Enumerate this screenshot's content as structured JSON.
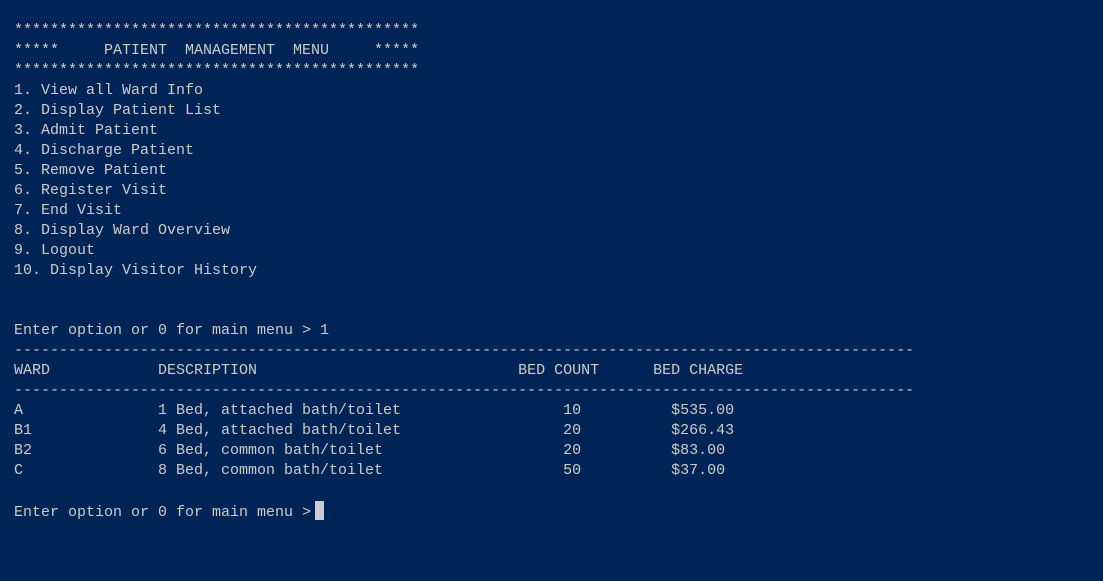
{
  "colors": {
    "background": "#012456",
    "text": "#cccccc"
  },
  "banner": {
    "border": "*********************************************",
    "title_line": "*****     PATIENT  MANAGEMENT  MENU     *****"
  },
  "menu": [
    "1. View all Ward Info",
    "2. Display Patient List",
    "3. Admit Patient",
    "4. Discharge Patient",
    "5. Remove Patient",
    "6. Register Visit",
    "7. End Visit",
    "8. Display Ward Overview",
    "9. Logout",
    "10. Display Visitor History"
  ],
  "first_prompt": "Enter option or 0 for main menu > 1",
  "separator": "----------------------------------------------------------------------------------------------------",
  "table": {
    "headers": {
      "ward": "WARD",
      "description": "DESCRIPTION",
      "bed_count": "BED COUNT",
      "bed_charge": "BED CHARGE"
    },
    "rows": [
      {
        "ward": "A",
        "description": "1 Bed, attached bath/toilet",
        "bed_count": "10",
        "bed_charge": "$535.00"
      },
      {
        "ward": "B1",
        "description": "4 Bed, attached bath/toilet",
        "bed_count": "20",
        "bed_charge": "$266.43"
      },
      {
        "ward": "B2",
        "description": "6 Bed, common bath/toilet",
        "bed_count": "20",
        "bed_charge": "$83.00"
      },
      {
        "ward": "C",
        "description": "8 Bed, common bath/toilet",
        "bed_count": "50",
        "bed_charge": "$37.00"
      }
    ]
  },
  "current_prompt": "Enter option or 0 for main menu >"
}
